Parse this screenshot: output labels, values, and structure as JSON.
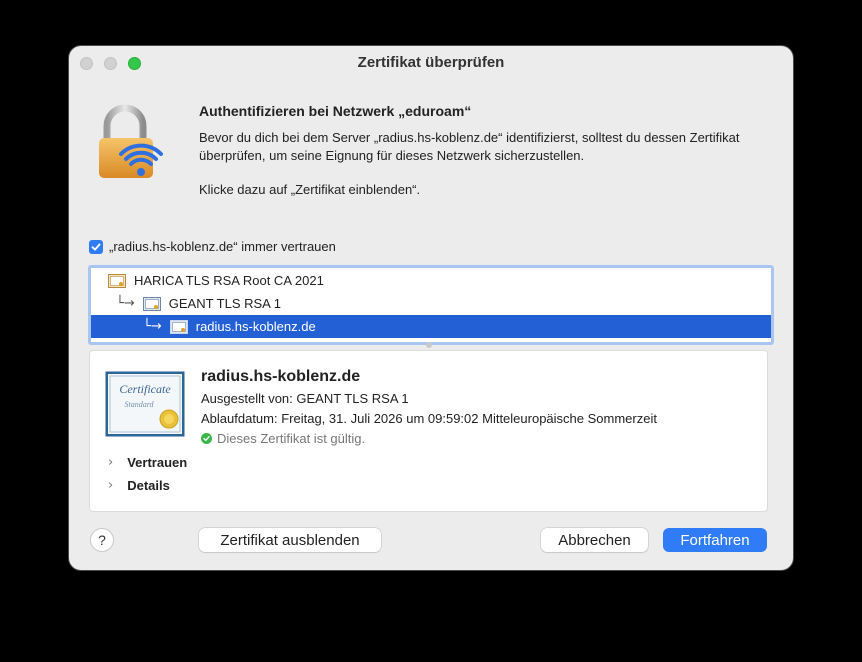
{
  "window": {
    "title": "Zertifikat überprüfen"
  },
  "header": {
    "heading": "Authentifizieren bei Netzwerk „eduroam“",
    "paragraph1": "Bevor du dich bei dem Server „radius.hs-koblenz.de“ identifizierst, solltest du dessen Zertifikat überprüfen, um seine Eignung für dieses Netzwerk sicherzustellen.",
    "paragraph2": "Klicke dazu auf „Zertifikat einblenden“."
  },
  "trust": {
    "checked": true,
    "label": "„radius.hs-koblenz.de“ immer vertrauen"
  },
  "tree": {
    "items": [
      {
        "label": "HARICA TLS RSA Root CA 2021",
        "arrow": ""
      },
      {
        "label": "GEANT TLS RSA 1",
        "arrow": "└→"
      },
      {
        "label": "radius.hs-koblenz.de",
        "arrow": "└→",
        "selected": true
      }
    ]
  },
  "detail": {
    "cert_icon_text_1": "Certificate",
    "cert_icon_text_2": "Standard",
    "name": "radius.hs-koblenz.de",
    "issuer": "Ausgestellt von: GEANT TLS RSA 1",
    "expiry": "Ablaufdatum: Freitag, 31. Juli 2026 um 09:59:02 Mitteleuropäische Sommerzeit",
    "status": "Dieses Zertifikat ist gültig.",
    "status_color": "#3ab54a",
    "sections": [
      "Vertrauen",
      "Details"
    ]
  },
  "buttons": {
    "help": "?",
    "hide_certificate": "Zertifikat ausblenden",
    "cancel": "Abbrechen",
    "continue": "Fortfahren"
  },
  "colors": {
    "accent": "#2f7cf6",
    "selection": "#2360d6"
  }
}
